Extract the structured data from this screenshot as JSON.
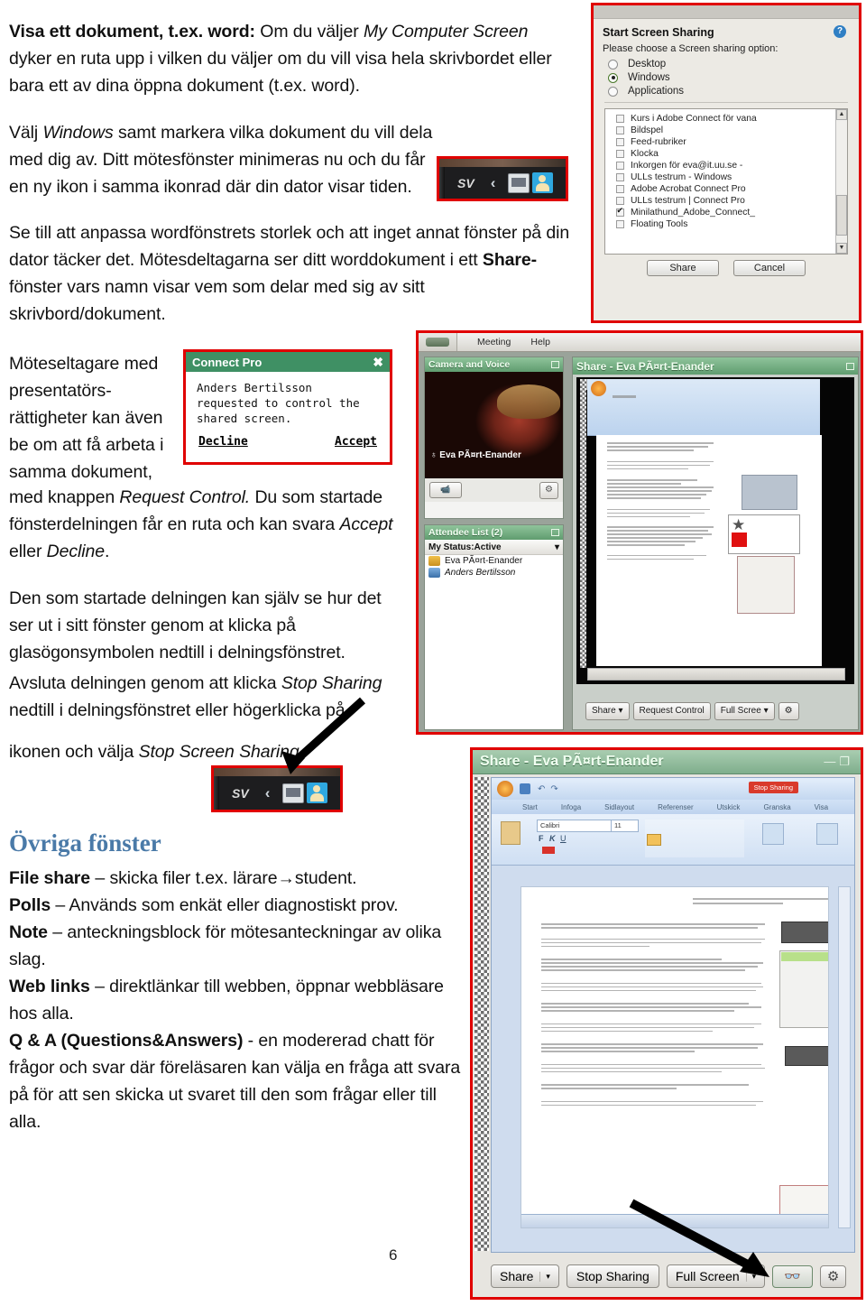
{
  "document": {
    "page_number": "6",
    "paragraphs": [
      {
        "id": "p1",
        "runs": [
          {
            "text": "Visa ett dokument, t.ex. word:",
            "style": "bold"
          },
          {
            "text": " Om du väljer ",
            "style": "normal"
          },
          {
            "text": "My Computer Screen",
            "style": "italic"
          },
          {
            "text": " dyker en ruta upp i vilken du väljer om du vill visa hela skrivbordet eller bara ett av dina öppna dokument (t.ex. word).",
            "style": "normal"
          }
        ]
      },
      {
        "id": "p2",
        "runs": [
          {
            "text": "Välj ",
            "style": "normal"
          },
          {
            "text": "Windows",
            "style": "italic"
          },
          {
            "text": " samt markera vilka dokument du vill dela med dig av. Ditt mötesfönster minimeras nu och du får en ny ikon i samma ikonrad där din dator visar tiden.",
            "style": "normal"
          }
        ]
      },
      {
        "id": "p3",
        "runs": [
          {
            "text": "Se till att anpassa wordfönstrets storlek och att inget annat fönster på din dator täcker det. Mötesdeltagarna ser ditt worddokument i ett ",
            "style": "normal"
          },
          {
            "text": "Share-",
            "style": "bold"
          },
          {
            "text": "fönster vars namn visar vem som delar med sig av sitt skrivbord/dokument.",
            "style": "normal"
          }
        ]
      },
      {
        "id": "p4a",
        "runs": [
          {
            "text": "Möteseltagare med presentatörs-rättigheter kan även be om att få arbeta i samma dokument,",
            "style": "normal"
          }
        ]
      },
      {
        "id": "p4b",
        "runs": [
          {
            "text": "med knappen ",
            "style": "normal"
          },
          {
            "text": "Request Control.",
            "style": "italic"
          },
          {
            "text": " Du som startade fönsterdelningen får en ruta och kan svara ",
            "style": "normal"
          },
          {
            "text": "Accept",
            "style": "italic"
          },
          {
            "text": " eller ",
            "style": "normal"
          },
          {
            "text": "Decline",
            "style": "italic"
          },
          {
            "text": ".",
            "style": "normal"
          }
        ]
      },
      {
        "id": "p5",
        "runs": [
          {
            "text": "Den som startade delningen kan själv se hur det ser ut i sitt fönster genom at klicka på glasögonsymbolen nedtill i delningsfönstret.",
            "style": "normal"
          }
        ]
      },
      {
        "id": "p6",
        "runs": [
          {
            "text": "Avsluta delningen genom att klicka ",
            "style": "normal"
          },
          {
            "text": "Stop Sharing",
            "style": "italic"
          },
          {
            "text": " nedtill i delningsfönstret eller högerklicka på",
            "style": "normal"
          }
        ]
      },
      {
        "id": "p7",
        "runs": [
          {
            "text": "ikonen och välja ",
            "style": "normal"
          },
          {
            "text": "Stop Screen Sharing.",
            "style": "italic"
          }
        ]
      }
    ],
    "section": {
      "heading": "Övriga fönster",
      "heading_color": "#4a7aa8",
      "items": [
        {
          "term": "File share",
          "dash": " – ",
          "desc": "skicka filer t.ex. lärare",
          "arrow": "→",
          "desc2": "student."
        },
        {
          "term": "Polls",
          "dash": " – ",
          "desc": "Används som enkät eller diagnostiskt prov.",
          "arrow": "",
          "desc2": ""
        },
        {
          "term": "Note",
          "dash": " – ",
          "desc": "anteckningsblock för mötesanteckningar av olika slag.",
          "arrow": "",
          "desc2": ""
        },
        {
          "term": "Web links",
          "dash": " – ",
          "desc": "direktlänkar till webben, öppnar webbläsare hos alla.",
          "arrow": "",
          "desc2": ""
        },
        {
          "term": "Q & A (Questions&Answers)",
          "dash": " - ",
          "desc": "en modererad chatt för frågor och svar där föreläsaren kan välja en fråga att svara på för att sen skicka ut svaret till den som frågar eller till alla.",
          "arrow": "",
          "desc2": ""
        }
      ]
    }
  },
  "screenshots": {
    "start_screen_sharing": {
      "title": "Start Screen Sharing",
      "help_glyph": "?",
      "prompt": "Please choose a Screen sharing option:",
      "options": [
        {
          "label": "Desktop",
          "selected": false
        },
        {
          "label": "Windows",
          "selected": true
        },
        {
          "label": "Applications",
          "selected": false
        }
      ],
      "window_list": [
        {
          "label": "Kurs i Adobe Connect för vana",
          "checked": false
        },
        {
          "label": "Bildspel",
          "checked": false
        },
        {
          "label": "Feed-rubriker",
          "checked": false
        },
        {
          "label": "Klocka",
          "checked": false
        },
        {
          "label": "Inkorgen för eva@it.uu.se -",
          "checked": false
        },
        {
          "label": "ULLs testrum - Windows",
          "checked": false
        },
        {
          "label": "Adobe Acrobat Connect Pro",
          "checked": false
        },
        {
          "label": "ULLs testrum | Connect Pro",
          "checked": false
        },
        {
          "label": "Minilathund_Adobe_Connect_",
          "checked": true
        },
        {
          "label": "Floating Tools",
          "checked": false
        }
      ],
      "scroll_up_glyph": "▲",
      "scroll_down_glyph": "▼",
      "buttons": [
        {
          "label": "Share"
        },
        {
          "label": "Cancel"
        }
      ]
    },
    "taskbar_icon_top": {
      "language_indicator": "SV",
      "chevron": "‹",
      "icons": [
        "screen-share-icon",
        "connect-user-icon"
      ]
    },
    "taskbar_icon_bottom": {
      "language_indicator": "SV",
      "chevron": "‹",
      "icons": [
        "screen-share-icon",
        "connect-user-icon"
      ]
    },
    "connect_pro_request": {
      "title": "Connect Pro",
      "close_glyph": "✖",
      "message_lines": [
        "Anders Bertilsson",
        "requested to control the",
        "shared screen."
      ],
      "decline_label": "Decline",
      "accept_label": "Accept",
      "titlebar_color": "#3f9064"
    },
    "connect_pro_app": {
      "menu": [
        "Meeting",
        "Help"
      ],
      "camera_pod": {
        "title": "Camera and Voice",
        "speaker_name": "Eva PÃ¤rt-Enander",
        "mic_glyph": "♁"
      },
      "attendee_pod": {
        "title": "Attendee List (2)",
        "status_label": "My Status:Active",
        "status_caret": "▾",
        "attendees": [
          {
            "name": "Eva PÃ¤rt-Enander",
            "role": "host"
          },
          {
            "name": "Anders Bertilsson",
            "role": "presenter"
          }
        ]
      },
      "share_pod": {
        "title": "Share - Eva PÃ¤rt-Enander",
        "buttons": [
          {
            "label": "Share",
            "caret": "▾"
          },
          {
            "label": "Request Control",
            "caret": ""
          },
          {
            "label": "Full Scree",
            "caret": "▾"
          },
          {
            "label": "",
            "caret": "",
            "icon": "gear-icon"
          }
        ]
      }
    },
    "share_window_bottom": {
      "title": "Share - Eva PÃ¤rt-Enander",
      "minimize_glyph": "—",
      "maximize_glyph": "❐",
      "word_stop_sharing_badge": "Stop Sharing",
      "ribbon_tabs": [
        "Start",
        "Infoga",
        "Sidlayout",
        "Referenser",
        "Utskick",
        "Granska",
        "Visa"
      ],
      "font_name": "Calibri",
      "font_size": "11",
      "buttons": [
        {
          "label": "Share",
          "caret": "▾"
        },
        {
          "label": "Stop Sharing",
          "caret": ""
        },
        {
          "label": "Full Screen",
          "caret": "▾"
        },
        {
          "label": "",
          "caret": "",
          "icon": "glasses-icon"
        },
        {
          "label": "",
          "caret": "",
          "icon": "gear-icon"
        }
      ]
    }
  }
}
